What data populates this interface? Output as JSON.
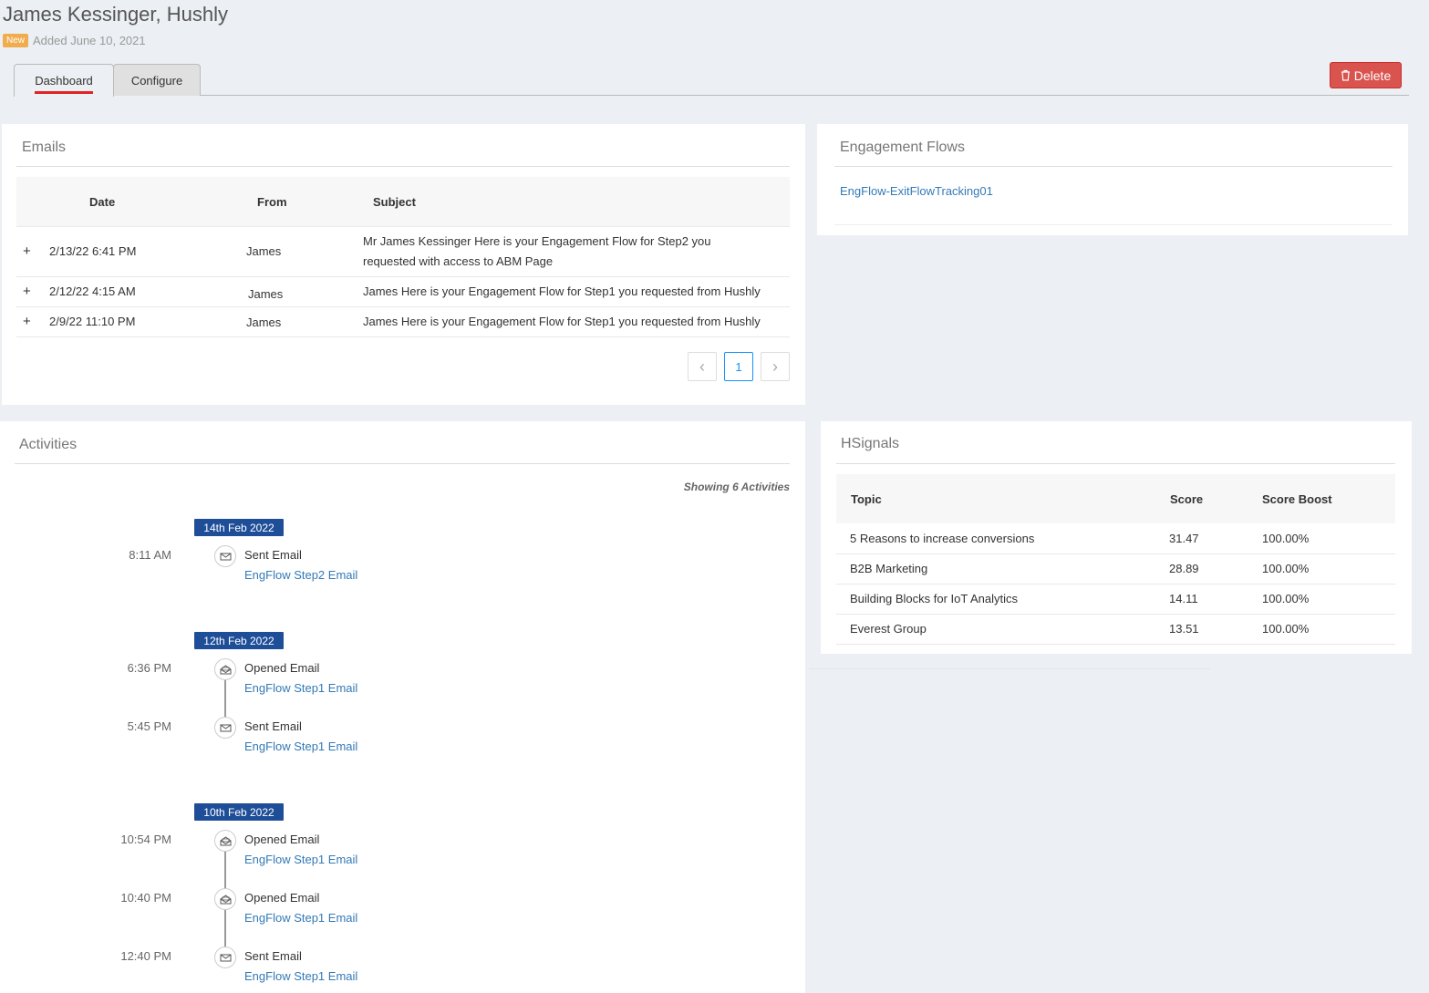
{
  "header": {
    "title": "James Kessinger, Hushly",
    "badge": "New",
    "added": "Added June 10, 2021"
  },
  "tabs": [
    {
      "label": "Dashboard",
      "active": true
    },
    {
      "label": "Configure",
      "active": false
    }
  ],
  "actions": {
    "delete_label": "Delete"
  },
  "emails": {
    "title": "Emails",
    "columns": [
      "Date",
      "From",
      "Subject"
    ],
    "rows": [
      {
        "date": "2/13/22 6:41 PM",
        "from": "James",
        "subject_line1": "Mr James Kessinger Here is your Engagement Flow for Step2 you",
        "subject_line2": "requested with access to ABM Page"
      },
      {
        "date": "2/12/22 4:15 AM",
        "from": "James",
        "subject_line1": "James Here is your Engagement Flow for Step1 you requested from Hushly"
      },
      {
        "date": "2/9/22 11:10 PM",
        "from": "James",
        "subject_line1": "James Here is your Engagement Flow for Step1 you requested from Hushly"
      }
    ],
    "pagination": {
      "current": "1",
      "prev_icon": "‹",
      "next_icon": "›"
    }
  },
  "engagement_flows": {
    "title": "Engagement Flows",
    "items": [
      "EngFlow-ExitFlowTracking01"
    ]
  },
  "activities": {
    "title": "Activities",
    "summary": "Showing 6 Activities",
    "groups": [
      {
        "date": "14th Feb 2022",
        "items": [
          {
            "time": "8:11 AM",
            "type": "Sent Email",
            "link": "EngFlow Step2 Email",
            "icon": "envelope-icon"
          }
        ]
      },
      {
        "date": "12th Feb 2022",
        "items": [
          {
            "time": "6:36 PM",
            "type": "Opened Email",
            "link": "EngFlow Step1 Email",
            "icon": "envelope-open-icon"
          },
          {
            "time": "5:45 PM",
            "type": "Sent Email",
            "link": "EngFlow Step1 Email",
            "icon": "envelope-icon"
          }
        ]
      },
      {
        "date": "10th Feb 2022",
        "items": [
          {
            "time": "10:54 PM",
            "type": "Opened Email",
            "link": "EngFlow Step1 Email",
            "icon": "envelope-open-icon"
          },
          {
            "time": "10:40 PM",
            "type": "Opened Email",
            "link": "EngFlow Step1 Email",
            "icon": "envelope-open-icon"
          },
          {
            "time": "12:40 PM",
            "type": "Sent Email",
            "link": "EngFlow Step1 Email",
            "icon": "envelope-icon"
          }
        ]
      }
    ]
  },
  "hsignals": {
    "title": "HSignals",
    "columns": [
      "Topic",
      "Score",
      "Score Boost"
    ],
    "rows": [
      {
        "topic": "5 Reasons to increase conversions",
        "score": "31.47",
        "boost": "100.00%"
      },
      {
        "topic": "B2B Marketing",
        "score": "28.89",
        "boost": "100.00%"
      },
      {
        "topic": "Building Blocks for IoT Analytics",
        "score": "14.11",
        "boost": "100.00%"
      },
      {
        "topic": "Everest Group",
        "score": "13.51",
        "boost": "100.00%"
      }
    ]
  },
  "colors": {
    "accent": "#337ab7",
    "danger": "#d9534f",
    "date_badge": "#1f4e99",
    "new_badge": "#f0ad4e"
  }
}
